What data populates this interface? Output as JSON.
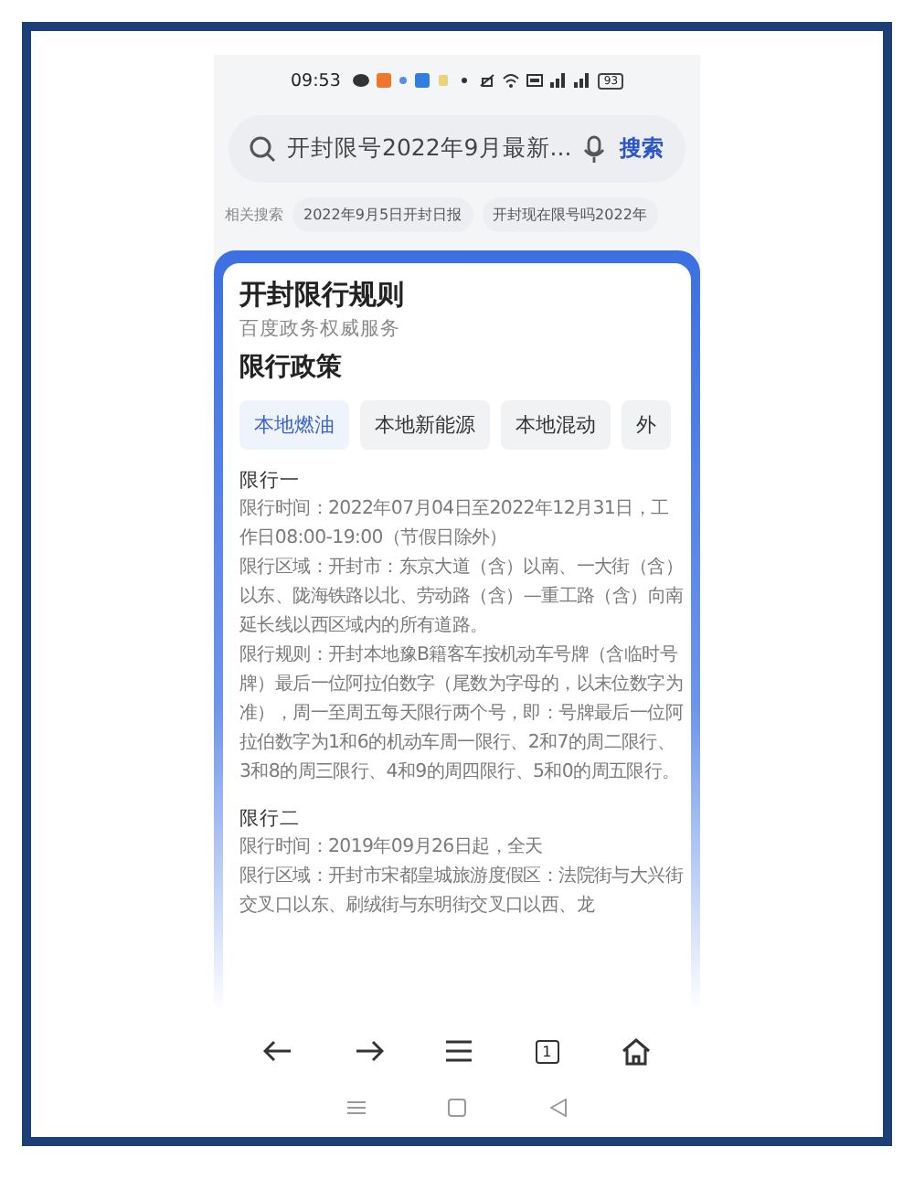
{
  "status_bar": {
    "time": "09:53",
    "battery": "93"
  },
  "search": {
    "query": "开封限号2022年9月最新...",
    "button": "搜索"
  },
  "related": {
    "label": "相关搜索",
    "items": [
      "2022年9月5日开封日报",
      "开封现在限号吗2022年"
    ]
  },
  "card": {
    "title": "开封限行规则",
    "subtitle": "百度政务权威服务",
    "section_title": "限行政策",
    "tabs": [
      {
        "label": "本地燃油",
        "selected": true
      },
      {
        "label": "本地新能源",
        "selected": false
      },
      {
        "label": "本地混动",
        "selected": false
      },
      {
        "label": "外",
        "selected": false
      }
    ],
    "sections": [
      {
        "heading": "限行一",
        "paragraphs": [
          "限行时间：2022年07月04日至2022年12月31日，工作日08:00-19:00（节假日除外）",
          "限行区域：开封市：东京大道（含）以南、一大街（含）以东、陇海铁路以北、劳动路（含）—重工路（含）向南延长线以西区域内的所有道路。",
          "限行规则：开封本地豫B籍客车按机动车号牌（含临时号牌）最后一位阿拉伯数字（尾数为字母的，以末位数字为准），周一至周五每天限行两个号，即：号牌最后一位阿拉伯数字为1和6的机动车周一限行、2和7的周二限行、3和8的周三限行、4和9的周四限行、5和0的周五限行。"
        ]
      },
      {
        "heading": "限行二",
        "paragraphs": [
          "限行时间：2019年09月26日起，全天",
          "限行区域：开封市宋都皇城旅游度假区：法院街与大兴街交叉口以东、刷绒街与东明街交叉口以西、龙"
        ]
      }
    ]
  },
  "toolbar": {
    "tab_count": "1"
  }
}
